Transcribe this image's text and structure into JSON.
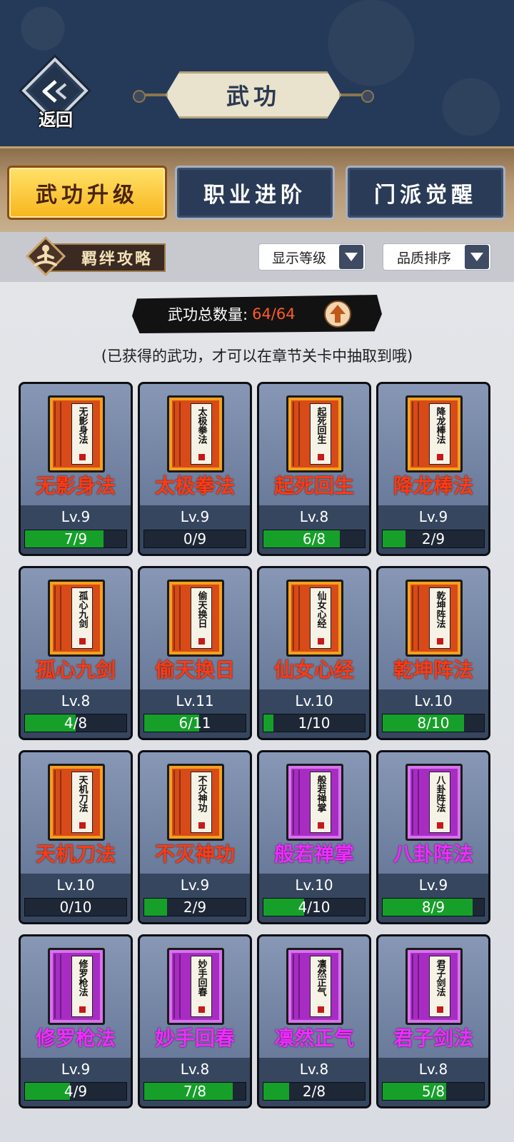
{
  "header": {
    "back_label": "返回",
    "title": "武功"
  },
  "tabs": [
    {
      "label": "武功升级",
      "active": true
    },
    {
      "label": "职业进阶",
      "active": false
    },
    {
      "label": "门派觉醒",
      "active": false
    }
  ],
  "toolbar": {
    "bond_label": "羁绊攻略",
    "level_select": "显示等级",
    "quality_select": "品质排序"
  },
  "summary": {
    "label": "武功总数量:",
    "count": "64/64"
  },
  "hint": "(已获得的武功，才可以在章节关卡中抽取到哦)",
  "colors": {
    "orange_name": "#ff3b14",
    "purple_name": "#f02cff",
    "progress_fill": "#16a02a"
  },
  "skills": [
    {
      "name": "无影身法",
      "book": "无影身法",
      "quality": "orange",
      "level": "Lv.9",
      "progress": "7/9",
      "fraction": 0.778
    },
    {
      "name": "太极拳法",
      "book": "太极拳法",
      "quality": "orange",
      "level": "Lv.9",
      "progress": "0/9",
      "fraction": 0
    },
    {
      "name": "起死回生",
      "book": "起死回生",
      "quality": "orange",
      "level": "Lv.8",
      "progress": "6/8",
      "fraction": 0.75
    },
    {
      "name": "降龙棒法",
      "book": "降龙棒法",
      "quality": "orange",
      "level": "Lv.9",
      "progress": "2/9",
      "fraction": 0.222
    },
    {
      "name": "孤心九剑",
      "book": "孤心九剑",
      "quality": "orange",
      "level": "Lv.8",
      "progress": "4/8",
      "fraction": 0.5
    },
    {
      "name": "偷天换日",
      "book": "偷天换日",
      "quality": "orange",
      "level": "Lv.11",
      "progress": "6/11",
      "fraction": 0.545
    },
    {
      "name": "仙女心经",
      "book": "仙女心经",
      "quality": "orange",
      "level": "Lv.10",
      "progress": "1/10",
      "fraction": 0.1
    },
    {
      "name": "乾坤阵法",
      "book": "乾坤阵法",
      "quality": "orange",
      "level": "Lv.10",
      "progress": "8/10",
      "fraction": 0.8
    },
    {
      "name": "天机刀法",
      "book": "天机刀法",
      "quality": "orange",
      "level": "Lv.10",
      "progress": "0/10",
      "fraction": 0
    },
    {
      "name": "不灭神功",
      "book": "不灭神功",
      "quality": "orange",
      "level": "Lv.9",
      "progress": "2/9",
      "fraction": 0.222
    },
    {
      "name": "般若禅掌",
      "book": "般若禅掌",
      "quality": "purple",
      "level": "Lv.10",
      "progress": "4/10",
      "fraction": 0.4
    },
    {
      "name": "八卦阵法",
      "book": "八卦阵法",
      "quality": "purple",
      "level": "Lv.9",
      "progress": "8/9",
      "fraction": 0.889
    },
    {
      "name": "修罗枪法",
      "book": "修罗枪法",
      "quality": "purple",
      "level": "Lv.9",
      "progress": "4/9",
      "fraction": 0.444
    },
    {
      "name": "妙手回春",
      "book": "妙手回春",
      "quality": "purple",
      "level": "Lv.8",
      "progress": "7/8",
      "fraction": 0.875
    },
    {
      "name": "凛然正气",
      "book": "凛然正气",
      "quality": "purple",
      "level": "Lv.8",
      "progress": "2/8",
      "fraction": 0.25
    },
    {
      "name": "君子剑法",
      "book": "君子剑法",
      "quality": "purple",
      "level": "Lv.8",
      "progress": "5/8",
      "fraction": 0.625
    }
  ]
}
